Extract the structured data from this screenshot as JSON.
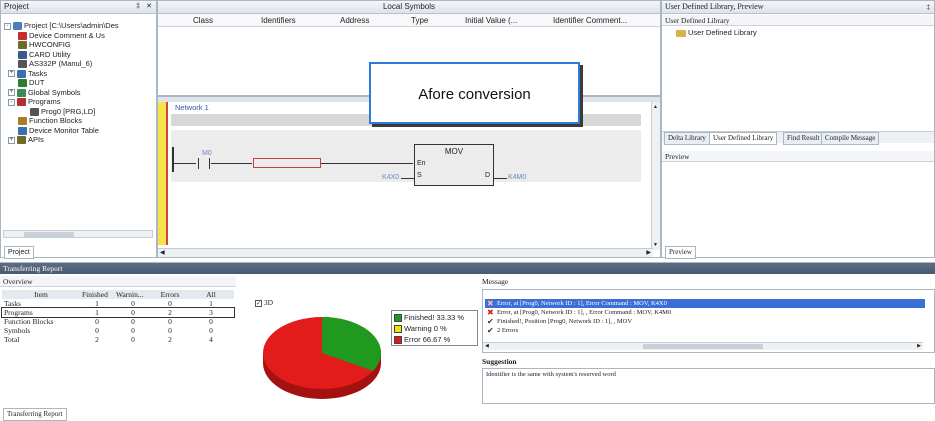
{
  "project_pane": {
    "title": "Project",
    "pin": "✕",
    "tab": "Project",
    "tree": [
      {
        "label": "Project [C:\\Users\\admin\\Des",
        "icon": "project-icon",
        "color": "#4a7fc0"
      },
      {
        "label": "Device Comment & Us",
        "icon": "device-comment-icon",
        "color": "#cc2b2b"
      },
      {
        "label": "HWCONFIG",
        "icon": "hwconfig-icon",
        "color": "#6b6b2a"
      },
      {
        "label": "CARD Utility",
        "icon": "card-utility-icon",
        "color": "#3b5a8a"
      },
      {
        "label": "AS332P  (Manul_6)",
        "icon": "plc-icon",
        "color": "#555"
      },
      {
        "label": "Tasks",
        "icon": "tasks-icon",
        "color": "#3a6fb0"
      },
      {
        "label": "DUT",
        "icon": "dut-icon",
        "color": "#2e7d32"
      },
      {
        "label": "Global Symbols",
        "icon": "global-symbols-icon",
        "color": "#3a8a5a"
      },
      {
        "label": "Programs",
        "icon": "programs-icon",
        "color": "#b03030"
      },
      {
        "label": "Prog0 [PRG,LD]",
        "icon": "prog-icon",
        "color": "#555"
      },
      {
        "label": "Function Blocks",
        "icon": "function-blocks-icon",
        "color": "#b07a20"
      },
      {
        "label": "Device Monitor Table",
        "icon": "monitor-table-icon",
        "color": "#3a6fb0"
      },
      {
        "label": "APIs",
        "icon": "apis-icon",
        "color": "#6b6b2a"
      }
    ]
  },
  "local_symbols": {
    "title": "Local Symbols",
    "columns": [
      "Class",
      "Identifiers",
      "Address",
      "Type",
      "Initial Value (...",
      "Identifier Comment..."
    ]
  },
  "editor": {
    "network_label": "Network 1",
    "contact_label": "M0",
    "fb_name": "MOV",
    "pin_en": "En",
    "pin_s": "S",
    "pin_d": "D",
    "input_operand": "K4X0",
    "output_operand": "K4M0"
  },
  "callout": {
    "text": "Afore conversion"
  },
  "library_pane": {
    "title": "User Defined Library, Preview",
    "subheader": "User Defined Library",
    "item": "User Defined Library",
    "tabs": [
      "Delta Library",
      "User Defined Library",
      "Find Result",
      "Compile Message"
    ],
    "preview_title": "Preview",
    "preview_tab": "Preview"
  },
  "report": {
    "title": "Transferring Report",
    "overview_title": "Overview",
    "columns": [
      "Item",
      "Finished",
      "Warnin...",
      "Errors",
      "All"
    ],
    "rows": [
      [
        "Tasks",
        "1",
        "0",
        "0",
        "1"
      ],
      [
        "Programs",
        "1",
        "0",
        "2",
        "3"
      ],
      [
        "Function Blocks",
        "0",
        "0",
        "0",
        "0"
      ],
      [
        "Symbols",
        "0",
        "0",
        "0",
        "0"
      ],
      [
        "Total",
        "2",
        "0",
        "2",
        "4"
      ]
    ],
    "checkbox_3d_label": "3D",
    "legend": [
      {
        "label": "Finished! 33.33 %",
        "color": "#1e9a1e"
      },
      {
        "label": "Warning 0 %",
        "color": "#f2e600"
      },
      {
        "label": "Error 66.67 %",
        "color": "#e01818"
      }
    ],
    "pie_fraction_finished": 0.3333,
    "message_title": "Message",
    "messages": [
      {
        "icon": "error-icon",
        "text": "Error, at [Prog0, Network ID : 1], Error Command : MOV, K4X0",
        "selected": true
      },
      {
        "icon": "error-icon",
        "text": "Error, at [Prog0, Network ID : 1], , Error Command : MOV, K4M0",
        "selected": false
      },
      {
        "icon": "check-icon",
        "text": "Finished!, Position [Prog0, Network ID : 1], , MOV",
        "selected": false
      },
      {
        "icon": "check-icon",
        "text": "2 Errors",
        "selected": false
      }
    ],
    "suggestion_title": "Suggestion",
    "suggestion_text": "Identifier is the same with system's reserved word",
    "bottom_tab": "Transferring Report"
  }
}
